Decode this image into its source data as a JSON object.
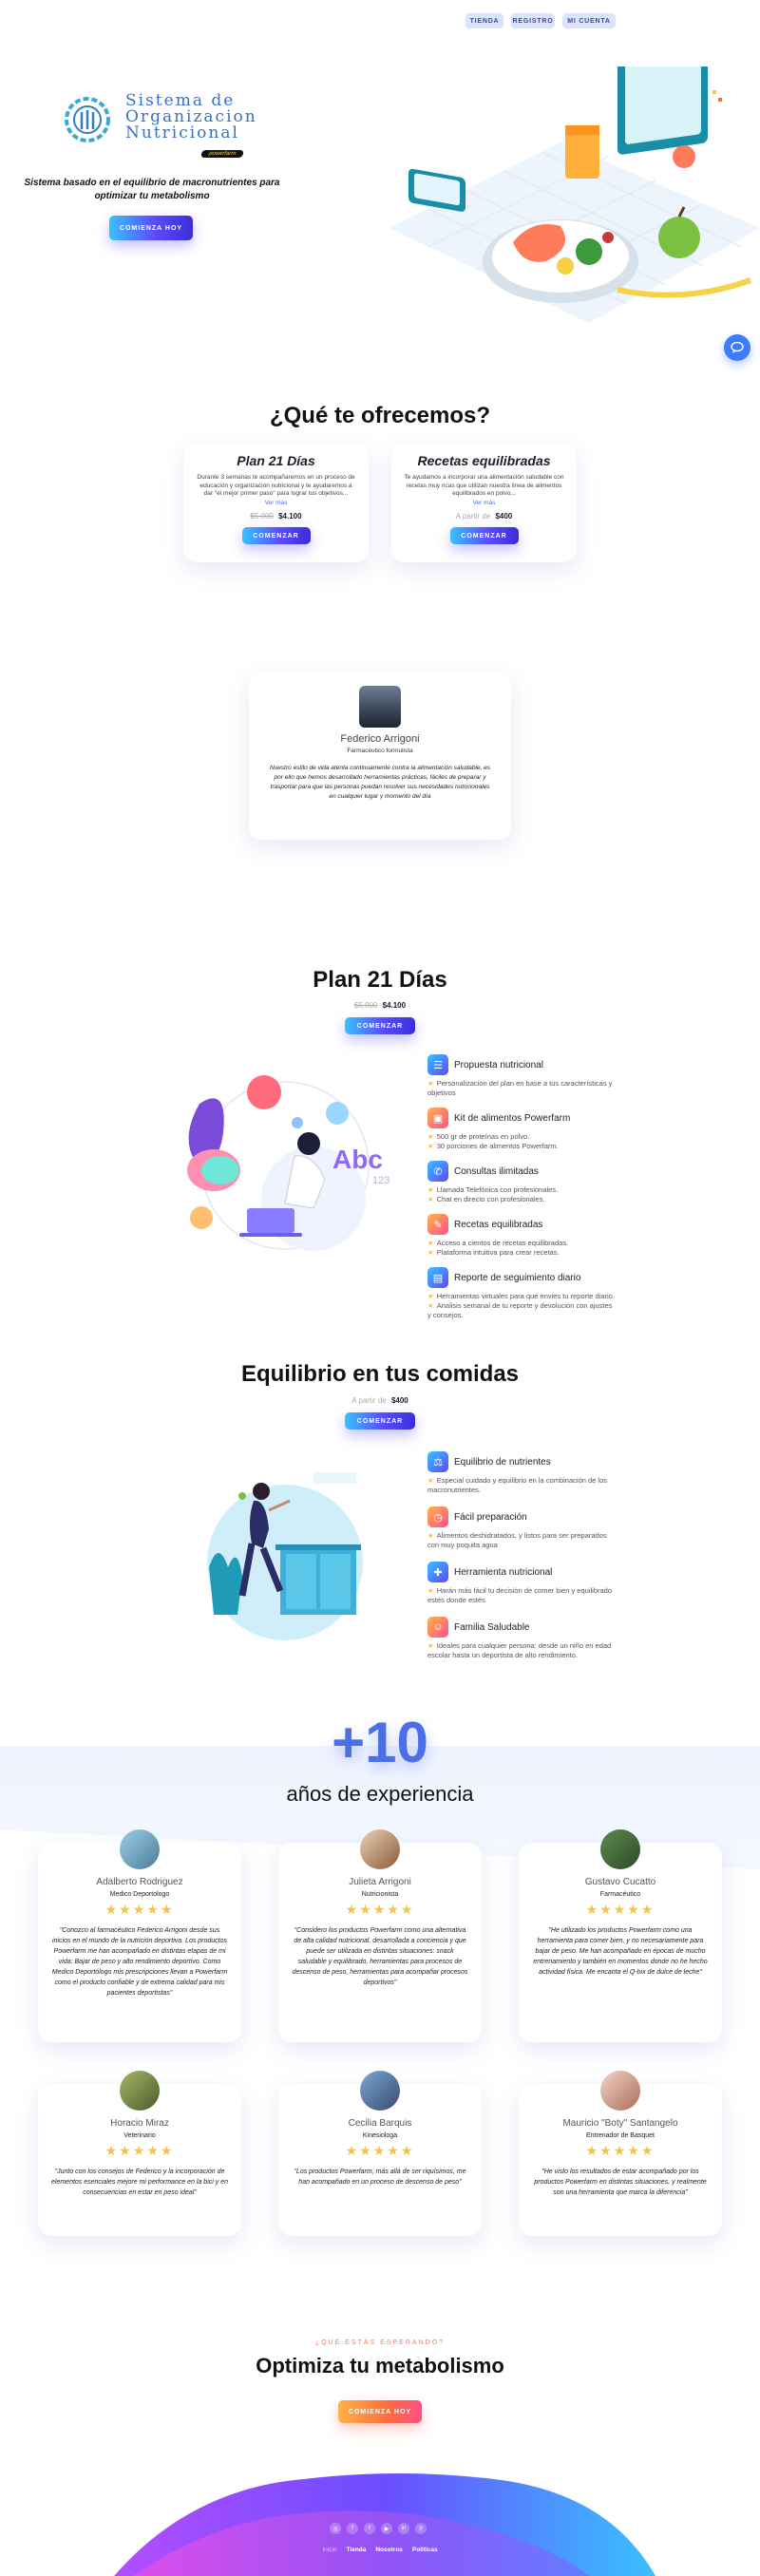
{
  "nav": {
    "items": [
      {
        "label": "TIENDA"
      },
      {
        "label": "REGISTRO"
      },
      {
        "label": "MI CUENTA"
      }
    ]
  },
  "hero": {
    "logo_line1": "Sistema de",
    "logo_line2": "Organizacion",
    "logo_line3": "Nutricional",
    "logo_badge": "powerfarm",
    "tagline": "Sistema basado en el equilibrio de macronutrientes para optimizar tu metabolismo",
    "cta": "COMIENZA HOY"
  },
  "offer": {
    "title": "¿Qué te ofrecemos?",
    "cards": [
      {
        "title": "Plan 21 Días",
        "desc": "Durante 3 semanas te acompañaremos en un proceso de educación y organización nutricional y te ayudaremos a dar \"el mejor primer paso\" para lograr tus objetivos...",
        "more": "Ver más",
        "old_price": "$5.000",
        "price": "$4.100",
        "cta": "COMENZAR"
      },
      {
        "title": "Recetas equilibradas",
        "desc": "Te ayudamos a incorporar una alimentación saludable con recetas muy ricas que utilizan nuestra línea de alimentos equilibrados en polvo...",
        "more": "Ver más",
        "old_price": "A partir de",
        "price": "$400",
        "cta": "COMENZAR"
      }
    ]
  },
  "founder": {
    "name": "Federico Arrigoni",
    "role": "Farmacéutico formulista",
    "quote": "Nuestro estilo de vida atenta continuamente contra la alimentación saludable, es por ello que hemos desarrollado herramientas prácticas, fáciles de preparar y trasportar para que las personas puedan resolver sus necesidades nutricionales en cualquier lugar y momento del día"
  },
  "plan": {
    "title": "Plan 21 Días",
    "old_price": "$5.000",
    "price": "$4.100",
    "cta": "COMENZAR",
    "illustration_text": "Abc",
    "illustration_num": "123",
    "features": [
      {
        "icon": "menu-icon",
        "title": "Propuesta nutricional",
        "bullets": [
          "Personalización del plan en base a tus características y objetivos"
        ]
      },
      {
        "icon": "box-icon",
        "title": "Kit de alimentos Powerfarm",
        "bullets": [
          "500 gr de proteínas en polvo.",
          "30 porciones de alimentos Powerfarm."
        ]
      },
      {
        "icon": "phone-icon",
        "title": "Consultas ilimitadas",
        "bullets": [
          "Llamada Telefónica con profesionales.",
          "Chat en directo con profesionales."
        ]
      },
      {
        "icon": "recipe-icon",
        "title": "Recetas equilibradas",
        "bullets": [
          "Acceso a cientos de recetas equilibradas.",
          "Plataforma intuitiva para crear recetas."
        ]
      },
      {
        "icon": "chart-icon",
        "title": "Reporte de seguimiento diario",
        "bullets": [
          "Herramientas virtuales para que envies tu reporte diario.",
          "Analisis semanal de tu reporte y devolución con ajustes y consejos."
        ]
      }
    ]
  },
  "balance": {
    "title": "Equilibrio en tus comidas",
    "price_prefix": "A partir de",
    "price": "$400",
    "cta": "COMENZAR",
    "features": [
      {
        "icon": "scale-icon",
        "title": "Equilibrio de nutrientes",
        "bullets": [
          "Especial cuidado y equilibrio en la combinación de los macronutrientes."
        ]
      },
      {
        "icon": "clock-icon",
        "title": "Fácil preparación",
        "bullets": [
          "Alimentos deshidratados, y listos para ser preparados con muy poquita agua"
        ]
      },
      {
        "icon": "tool-icon",
        "title": "Herramienta nutricional",
        "bullets": [
          "Harán más fácil tu decisión de comer bien y equilibrado estés donde estés."
        ]
      },
      {
        "icon": "family-icon",
        "title": "Familia Saludable",
        "bullets": [
          "Ideales para cualquier persona: desde un niño en edad escolar hasta un deportista de alto rendimiento."
        ]
      }
    ]
  },
  "experience": {
    "number": "+10",
    "label": "años de experiencia"
  },
  "testimonials": [
    {
      "name": "Adalberto Rodriguez",
      "role": "Medico Deportologo",
      "stars": "★★★★★",
      "quote": "\"Conozco al farmacéutico Federico Arrigoni desde sus inicios en el mundo de la nutrición deportiva. Los productos Powerfarm me han acompañado en distintas etapas de mi vida: Bajar de peso y alto rendimiento deportivo. Como Medico Deportólogo mis prescripciones llevan a Powerfarm como el producto confiable y de extrema calidad para mis pacientes deportistas\""
    },
    {
      "name": "Julieta Arrigoni",
      "role": "Nutricionista",
      "stars": "★★★★★",
      "quote": "\"Considero los productos Powerfarm como una alternativa de alta calidad nutricional, desarrollada a conciencia y que puede ser utilizada en distintas situaciones: snack saludable y equilibrado, herramientas para procesos de descenso de peso, herramientas para acompañar procesos deportivos\""
    },
    {
      "name": "Gustavo Cucatto",
      "role": "Farmacéutico",
      "stars": "★★★★★",
      "quote": "\"He utilizado los productos Powerfarm como una herramienta para comer bien, y no necesariamente para bajar de peso. Me han acompañado en épocas de mucho entrenamiento y también en momentos donde no he hecho actividad física. Me encanta el Q-bix de dulce de leche\""
    },
    {
      "name": "Horacio Miraz",
      "role": "Veterinario",
      "stars": "★★★★★",
      "quote": "\"Junto con los consejos de Federico y la incorporación de elementos esenciales mejore mi performance en la bici y en consecuencias en estar en peso ideal\""
    },
    {
      "name": "Cecilia Barquis",
      "role": "Kinesiologa",
      "stars": "★★★★★",
      "quote": "\"Los productos Powerfarm, más allá de ser riquísimos, me han acompañado en un proceso de descenso de peso\""
    },
    {
      "name": "Mauricio \"Boty\" Santangelo",
      "role": "Entrenador de Basquet",
      "stars": "★★★★★",
      "quote": "\"He visto los resultados de estar acompañado por los productos Powerfarm en distintas situaciones, y realmente son una herramienta que marca la diferencia\""
    }
  ],
  "final_cta": {
    "eyebrow": "¿QUÉ ESTÁS ESPERANDO?",
    "title": "Optimiza tu metabolismo",
    "cta": "COMIENZA HOY"
  },
  "footer": {
    "social": [
      {
        "icon": "instagram-icon",
        "glyph": "◎"
      },
      {
        "icon": "facebook-icon",
        "glyph": "f"
      },
      {
        "icon": "twitter-icon",
        "glyph": "t"
      },
      {
        "icon": "youtube-icon",
        "glyph": "▶"
      },
      {
        "icon": "linkedin-icon",
        "glyph": "in"
      },
      {
        "icon": "pinterest-icon",
        "glyph": "p"
      }
    ],
    "links": [
      {
        "label": "Inicio"
      },
      {
        "label": "Tienda"
      },
      {
        "label": "Nosotros"
      },
      {
        "label": "Politicas"
      }
    ]
  },
  "colors": {
    "primary": "#5b4bff",
    "accent": "#38c1ff",
    "orange": "#ff6a3d",
    "star": "#f6c245"
  }
}
